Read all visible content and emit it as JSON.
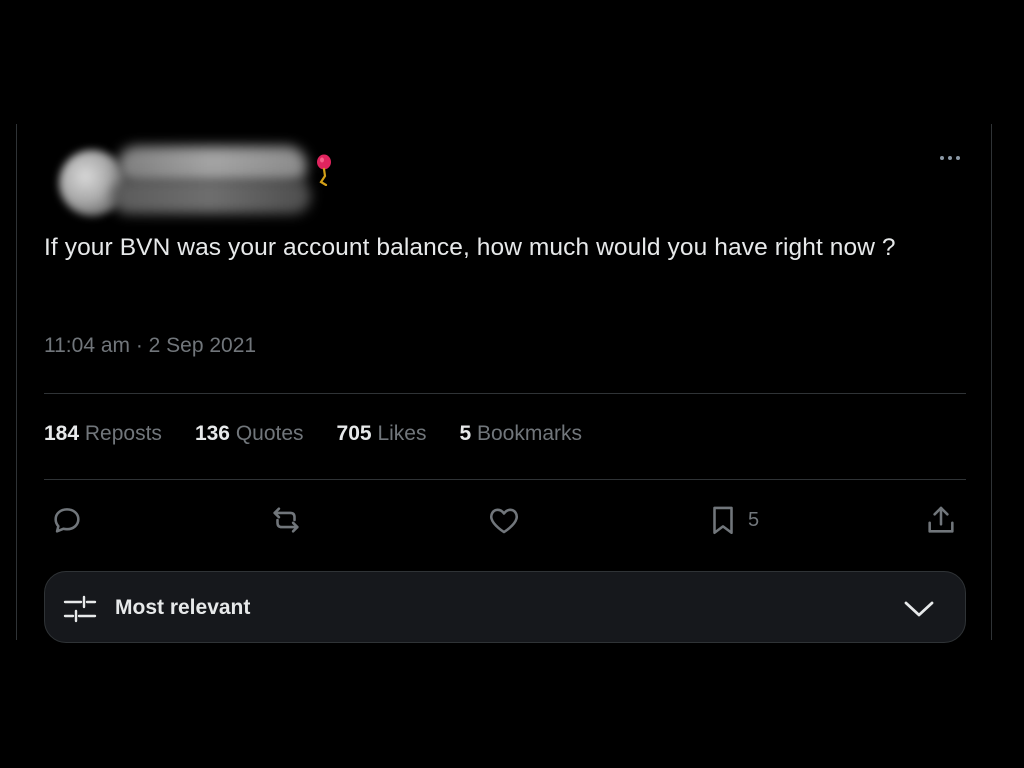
{
  "tweet": {
    "text": "If your BVN was your account balance, how much would you have right now ?",
    "timestamp": "11:04 am · 2 Sep 2021"
  },
  "author": {
    "avatar_icon": "avatar-blurred",
    "name_icon": "blurred-name",
    "badge_icon": "balloon-pin-icon"
  },
  "stats": [
    {
      "num": "184",
      "label": "Reposts"
    },
    {
      "num": "136",
      "label": "Quotes"
    },
    {
      "num": "705",
      "label": "Likes"
    },
    {
      "num": "5",
      "label": "Bookmarks"
    }
  ],
  "actions": {
    "reply_icon": "reply-icon",
    "repost_icon": "repost-icon",
    "like_icon": "like-icon",
    "bookmark_icon": "bookmark-icon",
    "bookmark_count": "5",
    "share_icon": "share-icon"
  },
  "sort": {
    "label": "Most relevant",
    "icon": "sliders-icon",
    "chevron": "chevron-down-icon"
  },
  "colors": {
    "background": "#000000",
    "text": "#e7e9ea",
    "muted": "#71767b",
    "border": "#2f3336",
    "sortbar_bg": "#16181c",
    "badge": "#f91880"
  }
}
